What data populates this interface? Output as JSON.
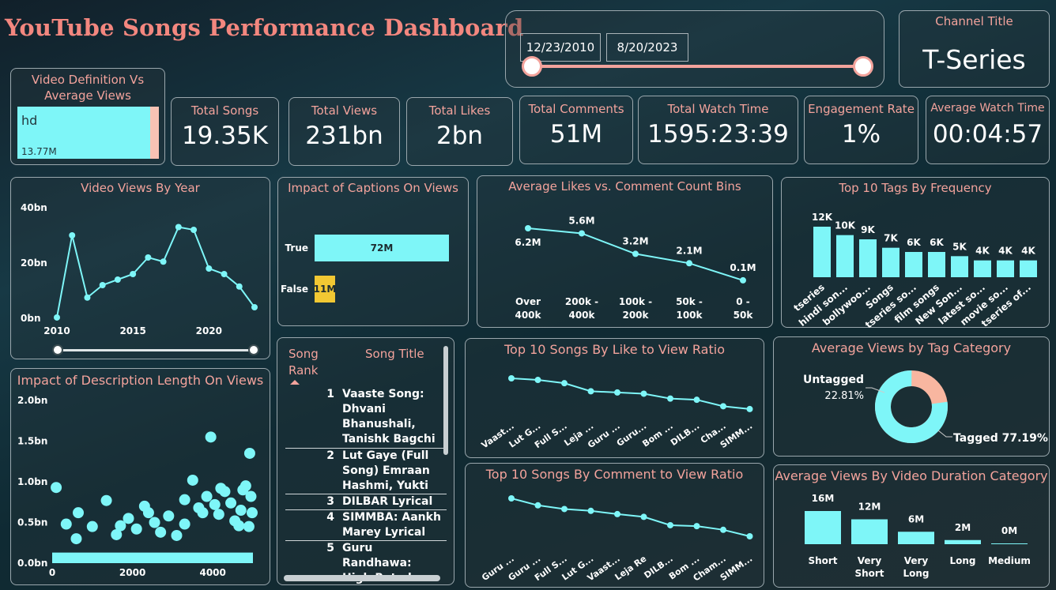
{
  "title": "YouTube Songs Performance Dashboard",
  "date_range": {
    "start": "12/23/2010",
    "end": "8/20/2023"
  },
  "channel": {
    "label": "Channel Title",
    "value": "T-Series"
  },
  "kpis": [
    {
      "label": "Total Songs",
      "value": "19.35K"
    },
    {
      "label": "Total Views",
      "value": "231bn"
    },
    {
      "label": "Total Likes",
      "value": "2bn"
    },
    {
      "label": "Total Comments",
      "value": "51M"
    },
    {
      "label": "Total Watch Time",
      "value": "1595:23:39"
    },
    {
      "label": "Engagement Rate",
      "value": "1%"
    },
    {
      "label": "Average Watch Time",
      "value": "00:04:57"
    }
  ],
  "video_def": {
    "title": "Video Definition Vs Average Views",
    "category": "hd",
    "value_label": "13.77M"
  },
  "table": {
    "head_rank": "Song Rank",
    "head_title": "Song Title",
    "rows": [
      {
        "rank": "1",
        "title": "Vaaste Song: Dhvani Bhanushali, Tanishk Bagchi"
      },
      {
        "rank": "2",
        "title": "Lut Gaye (Full Song) Emraan Hashmi, Yukti"
      },
      {
        "rank": "3",
        "title": "DILBAR Lyrical"
      },
      {
        "rank": "4",
        "title": "SIMMBA: Aankh Marey Lyrical"
      },
      {
        "rank": "5",
        "title": "Guru Randhawa: High Rated Gabru Official Song"
      }
    ]
  },
  "colors": {
    "cyan": "#7ef6f8",
    "salmon": "#f3a39c",
    "yellow": "#f2c833",
    "peach": "#f8b6a0"
  },
  "chart_data": [
    {
      "id": "views_by_year",
      "type": "line",
      "title": "Video Views By Year",
      "x": [
        2010,
        2011,
        2012,
        2013,
        2014,
        2015,
        2016,
        2017,
        2018,
        2019,
        2020,
        2021,
        2022,
        2023
      ],
      "values": [
        0.3,
        30,
        7.5,
        12,
        14,
        16,
        22,
        20.5,
        33,
        32,
        18,
        16,
        11.5,
        4
      ],
      "xticks": [
        "2010",
        "2015",
        "2020"
      ],
      "yticks": [
        "0bn",
        "20bn",
        "40bn"
      ],
      "ylim": [
        0,
        40
      ]
    },
    {
      "id": "captions",
      "type": "bar",
      "title": "Impact of Captions On Views",
      "categories": [
        "True",
        "False"
      ],
      "values": [
        72,
        11
      ],
      "labels": [
        "72M",
        "11M"
      ]
    },
    {
      "id": "likes_vs_comment_bins",
      "type": "line",
      "title": "Average Likes vs. Comment Count Bins",
      "categories": [
        "Over 400k",
        "200k - 400k",
        "100k - 200k",
        "50k - 100k",
        "0 - 50k"
      ],
      "values": [
        6.2,
        5.6,
        3.2,
        2.1,
        0.1
      ],
      "labels": [
        "6.2M",
        "5.6M",
        "3.2M",
        "2.1M",
        "0.1M"
      ]
    },
    {
      "id": "top_tags",
      "type": "bar",
      "title": "Top 10 Tags By Frequency",
      "categories": [
        "tseries",
        "hindi son...",
        "bollywoo...",
        "Songs",
        "tseries so...",
        "film songs",
        "New Son...",
        "latest so...",
        "movie so...",
        "tseries of..."
      ],
      "values": [
        12,
        10,
        9,
        7,
        6,
        6,
        5,
        4,
        4,
        4
      ],
      "labels": [
        "12K",
        "10K",
        "9K",
        "7K",
        "6K",
        "6K",
        "5K",
        "4K",
        "4K",
        "4K"
      ]
    },
    {
      "id": "like_view_ratio",
      "type": "line",
      "title": "Top 10 Songs By Like to View Ratio",
      "categories": [
        "Vaast...",
        "Lut G...",
        "Full S...",
        "Leja ...",
        "Guru ...",
        "Guru...",
        "Bom ...",
        "DILB...",
        "Cha...",
        "SIMM..."
      ],
      "values": [
        10,
        9.6,
        8.8,
        6.8,
        6.5,
        6.2,
        5.0,
        4.7,
        3.1,
        2.4
      ]
    },
    {
      "id": "comment_view_ratio",
      "type": "line",
      "title": "Top 10 Songs By Comment to View Ratio",
      "categories": [
        "Guru ...",
        "Guru ...",
        "Full S...",
        "Lut G...",
        "Vaast...",
        "Leja Re",
        "DILB...",
        "Bom ...",
        "Cham...",
        "SIMM..."
      ],
      "values": [
        10,
        8.5,
        7.7,
        7.3,
        6.6,
        6.0,
        4.2,
        4.0,
        3.2,
        1.8
      ]
    },
    {
      "id": "tag_category",
      "type": "pie",
      "title": "Average Views by Tag Category",
      "categories": [
        "Tagged",
        "Untagged"
      ],
      "values": [
        77.19,
        22.81
      ],
      "labels": [
        "Tagged 77.19%",
        "Untagged",
        "22.81%"
      ]
    },
    {
      "id": "duration_category",
      "type": "bar",
      "title": "Average Views By Video Duration Category",
      "categories": [
        "Short",
        "Very Short",
        "Very Long",
        "Long",
        "Medium"
      ],
      "values": [
        16,
        12,
        6,
        2,
        0.2
      ],
      "labels": [
        "16M",
        "12M",
        "6M",
        "2M",
        "0M"
      ]
    },
    {
      "id": "desc_length",
      "type": "scatter",
      "title": "Impact of Description Length On Views",
      "xticks": [
        "0",
        "2000",
        "4000"
      ],
      "yticks": [
        "0.0bn",
        "0.5bn",
        "1.0bn",
        "1.5bn",
        "2.0bn"
      ],
      "xlim": [
        0,
        5000
      ],
      "ylim": [
        0,
        2
      ],
      "points": [
        [
          100,
          0.93
        ],
        [
          350,
          0.48
        ],
        [
          600,
          0.3
        ],
        [
          650,
          0.62
        ],
        [
          1000,
          0.45
        ],
        [
          1350,
          0.77
        ],
        [
          1700,
          0.46
        ],
        [
          1900,
          0.55
        ],
        [
          2100,
          0.42
        ],
        [
          2300,
          0.7
        ],
        [
          2550,
          0.5
        ],
        [
          2700,
          0.38
        ],
        [
          2900,
          0.58
        ],
        [
          3100,
          0.34
        ],
        [
          3300,
          0.48
        ],
        [
          3500,
          1.02
        ],
        [
          3650,
          0.68
        ],
        [
          3750,
          0.62
        ],
        [
          3850,
          0.82
        ],
        [
          3950,
          1.55
        ],
        [
          4050,
          0.72
        ],
        [
          4150,
          0.6
        ],
        [
          4300,
          0.88
        ],
        [
          4450,
          0.74
        ],
        [
          4550,
          0.52
        ],
        [
          4650,
          0.46
        ],
        [
          4750,
          0.9
        ],
        [
          4820,
          0.95
        ],
        [
          4920,
          1.35
        ],
        [
          4950,
          0.82
        ],
        [
          4980,
          0.62
        ],
        [
          4900,
          0.45
        ],
        [
          4700,
          0.65
        ],
        [
          4200,
          0.92
        ],
        [
          3300,
          0.78
        ],
        [
          2400,
          0.62
        ],
        [
          1600,
          0.35
        ]
      ]
    }
  ]
}
